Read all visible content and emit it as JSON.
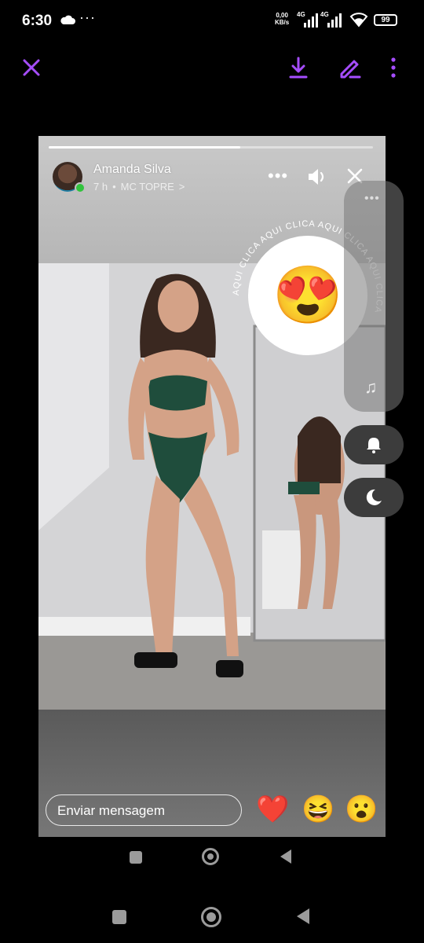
{
  "status_bar": {
    "time": "6:30",
    "net_speed_value": "0,00",
    "net_speed_unit": "KB/s",
    "signal1_label": "4G",
    "signal2_label": "4G",
    "battery": "99",
    "dots": "···"
  },
  "toolbar": {
    "accent_color": "#a64dff"
  },
  "story": {
    "author": "Amanda Silva",
    "time_ago": "7 h",
    "separator": "•",
    "music": "MC TOPRE",
    "music_chevron": ">",
    "progress": 0.59,
    "menu_dots": "•••"
  },
  "sticker": {
    "ring_text": "AQUI CLICA AQUI CLICA AQUI CLICA AQUI CLICA ",
    "emoji": "😍"
  },
  "side_panel": {
    "dots": "•••",
    "music_icon": "♫"
  },
  "footer": {
    "message_placeholder": "Enviar mensagem",
    "reactions": [
      "❤️",
      "😆",
      "😮"
    ]
  }
}
